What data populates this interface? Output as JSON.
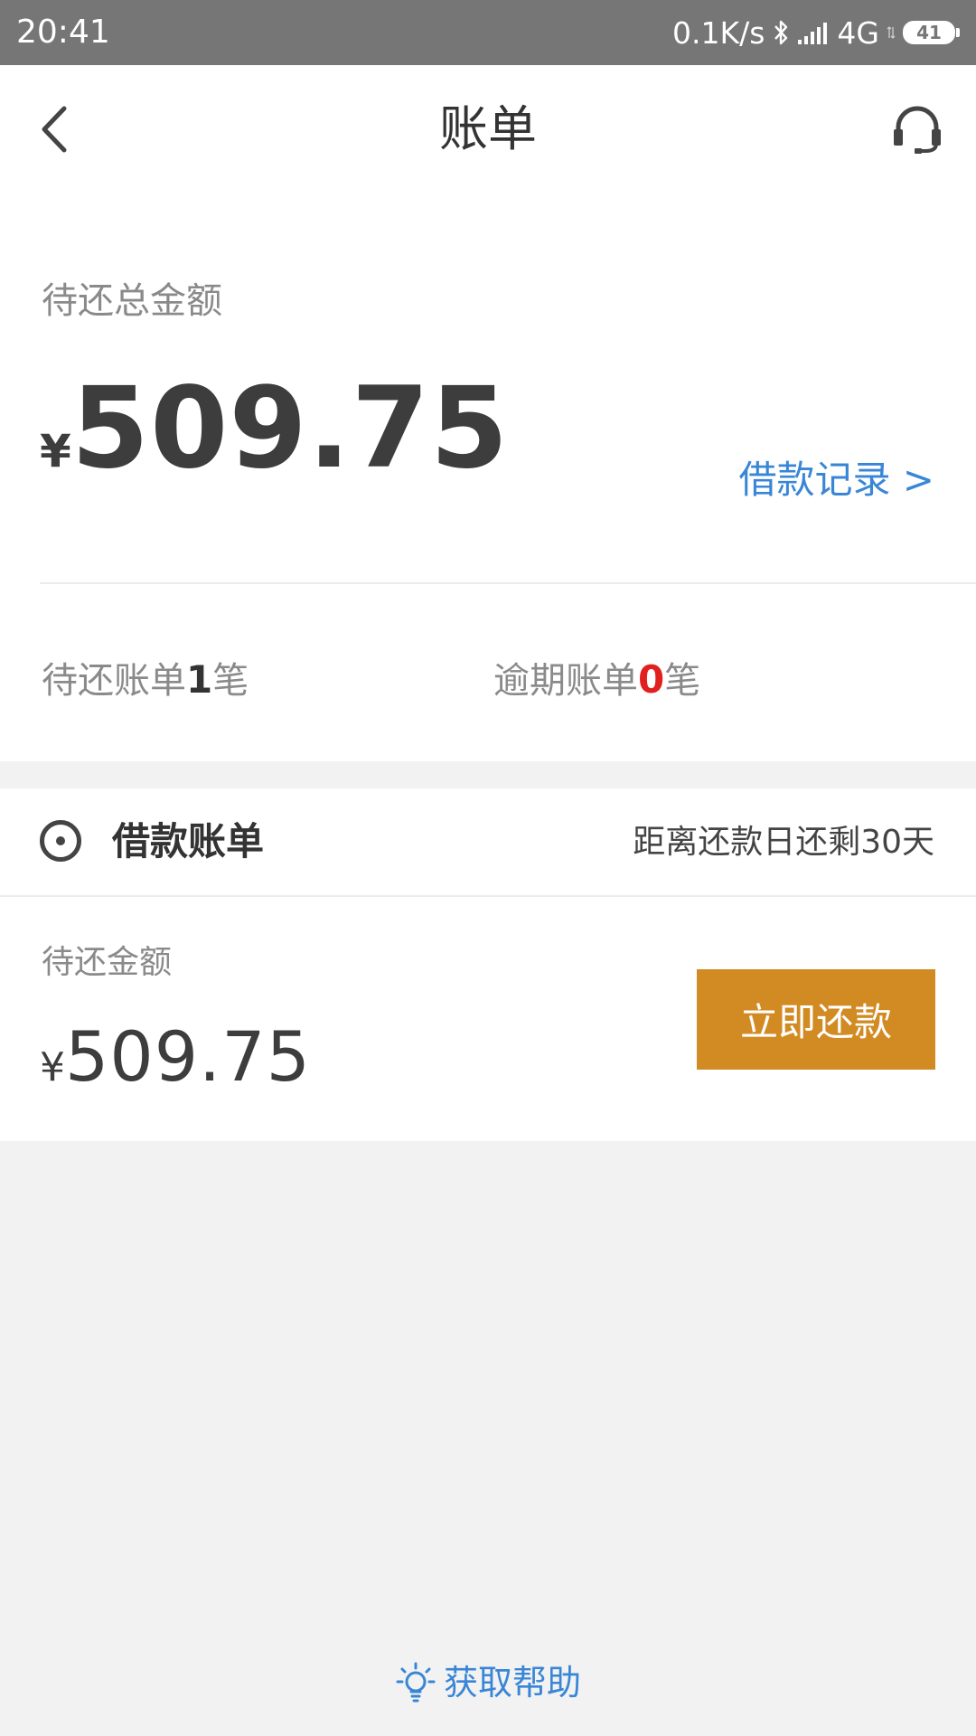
{
  "status_bar": {
    "time": "20:41",
    "speed": "0.1K/s",
    "network": "4G",
    "battery": "41",
    "icons": [
      "bluetooth-icon",
      "signal-icon",
      "battery-icon"
    ]
  },
  "header": {
    "title": "账单",
    "back_icon": "chevron-left-icon",
    "support_icon": "headset-icon"
  },
  "summary": {
    "label": "待还总金额",
    "currency": "¥",
    "amount": "509.75",
    "loan_record_link": "借款记录 >",
    "pending_prefix": "待还账单",
    "pending_count": "1",
    "pending_suffix": "笔",
    "overdue_prefix": "逾期账单",
    "overdue_count": "0",
    "overdue_suffix": "笔"
  },
  "bill": {
    "title": "借款账单",
    "due_text": "距离还款日还剩30天",
    "amount_label": "待还金额",
    "currency": "¥",
    "amount": "509.75",
    "repay_button": "立即还款"
  },
  "help": {
    "label": "获取帮助",
    "icon": "lightbulb-icon"
  },
  "colors": {
    "status_bar": "#767676",
    "link_blue": "#3a86d6",
    "button_orange": "#d28a22",
    "overdue_red": "#e0211f",
    "background": "#f2f2f2"
  }
}
